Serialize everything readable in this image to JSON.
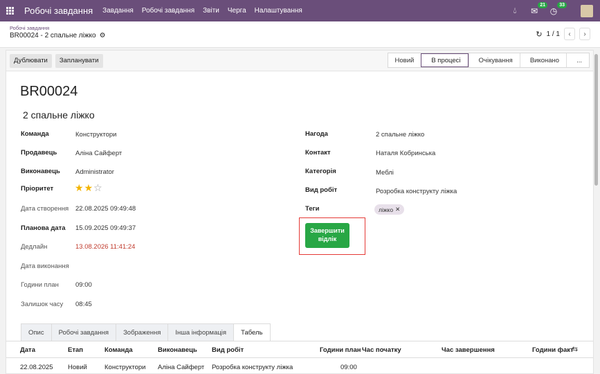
{
  "navbar": {
    "brand": "Робочі завдання",
    "menu": [
      "Завдання",
      "Робочі завдання",
      "Звіти",
      "Черга",
      "Налаштування"
    ],
    "messages_count": "21",
    "activity_count": "33"
  },
  "control_panel": {
    "breadcrumb": "Робочі завдання",
    "record_name": "BR00024 - 2 спальне ліжко",
    "pager": "1 / 1"
  },
  "actions": {
    "duplicate": "Дублювати",
    "schedule": "Запланувати"
  },
  "stages": [
    {
      "label": "Новий",
      "active": false
    },
    {
      "label": "В процесі",
      "active": true
    },
    {
      "label": "Очікування",
      "active": false
    },
    {
      "label": "Виконано",
      "active": false
    },
    {
      "label": "...",
      "active": false
    }
  ],
  "form": {
    "title": "BR00024",
    "subtitle": "2 спальне ліжко",
    "left": {
      "team_label": "Команда",
      "team_value": "Конструктори",
      "seller_label": "Продавець",
      "seller_value": "Аліна Сайферт",
      "executor_label": "Виконавець",
      "executor_value": "Administrator",
      "priority_label": "Пріоритет",
      "priority_stars": 2,
      "priority_max": 3,
      "created_label": "Дата створення",
      "created_value": "22.08.2025 09:49:48",
      "planned_label": "Планова дата",
      "planned_value": "15.09.2025 09:49:37",
      "deadline_label": "Дедлайн",
      "deadline_value": "13.08.2026 11:41:24",
      "done_label": "Дата виконання",
      "hours_plan_label": "Години план",
      "hours_plan_value": "09:00",
      "remaining_label": "Залишок часу",
      "remaining_value": "08:45"
    },
    "right": {
      "opportunity_label": "Нагода",
      "opportunity_value": "2 спальне ліжко",
      "contact_label": "Контакт",
      "contact_value": "Наталя Кобринська",
      "category_label": "Категорія",
      "category_value": "Меблі",
      "work_type_label": "Вид робіт",
      "work_type_value": "Розробка конструкту ліжка",
      "tags_label": "Теги",
      "tag": "ліжко"
    },
    "finish_button": "Завершити відлік"
  },
  "tabs": [
    {
      "label": "Опис",
      "active": false
    },
    {
      "label": "Робочі завдання",
      "active": false
    },
    {
      "label": "Зображення",
      "active": false
    },
    {
      "label": "Інша інформація",
      "active": false
    },
    {
      "label": "Табель",
      "active": true
    }
  ],
  "table": {
    "headers": [
      "Дата",
      "Етап",
      "Команда",
      "Виконавець",
      "Вид робіт",
      "Години план",
      "Час початку",
      "Час завершення",
      "Години факт"
    ],
    "rows": [
      [
        "22.08.2025",
        "Новий",
        "Конструктори",
        "Аліна Сайферт",
        "Розробка конструкту ліжка",
        "09:00",
        "",
        "",
        ""
      ]
    ]
  },
  "colors": {
    "navbar": "#6a4e7a",
    "finish_button": "#28a745",
    "deadline": "#c0392b",
    "highlight": "#e53935"
  }
}
